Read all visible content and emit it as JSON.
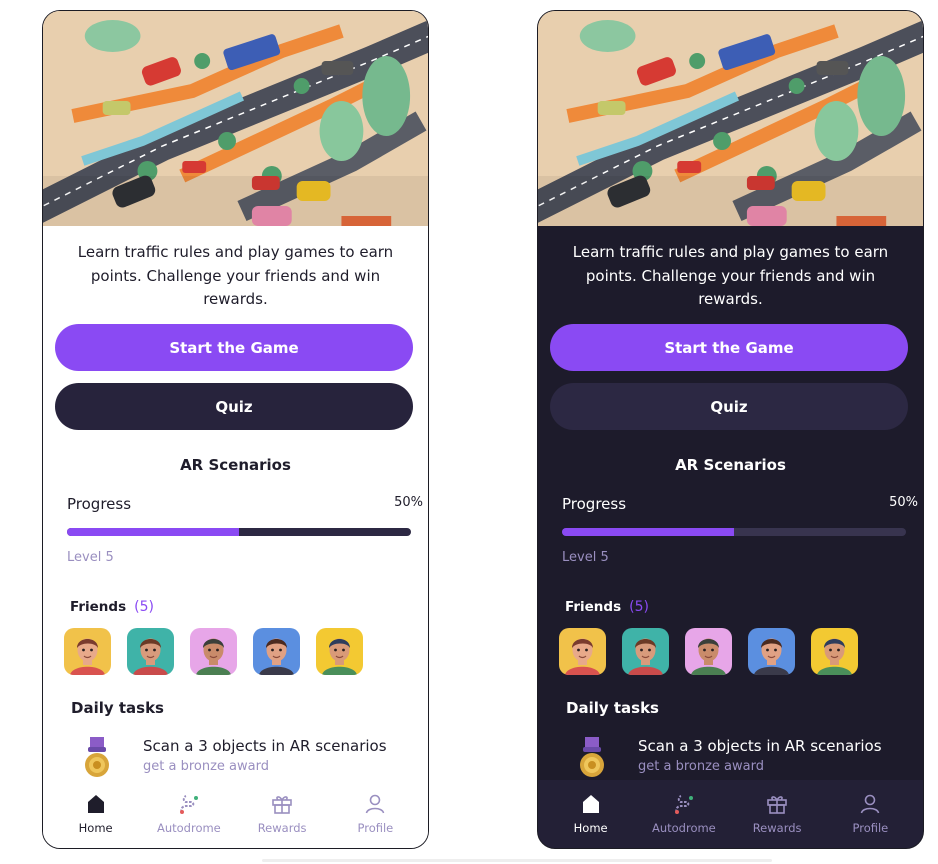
{
  "intro_text": "Learn traffic rules and play games to earn points. Challenge your friends and win rewards.",
  "buttons": {
    "start": "Start the Game",
    "quiz": "Quiz"
  },
  "ar_title": "AR Scenarios",
  "progress": {
    "label": "Progress",
    "percent_text": "50%",
    "value": 0.5,
    "level": "Level 5"
  },
  "friends": {
    "label": "Friends",
    "count": "(5)"
  },
  "daily": {
    "title": "Daily tasks",
    "task_title": "Scan a 3 objects in AR scenarios",
    "task_sub": "get a bronze award"
  },
  "tabs": [
    {
      "label": "Home",
      "icon": "home-icon"
    },
    {
      "label": "Autodrome",
      "icon": "track-icon"
    },
    {
      "label": "Rewards",
      "icon": "gift-icon"
    },
    {
      "label": "Profile",
      "icon": "user-icon"
    }
  ],
  "colors": {
    "accent": "#8a4af3",
    "dark_bg": "#1d1b2b",
    "muted": "#9a8fc0"
  }
}
